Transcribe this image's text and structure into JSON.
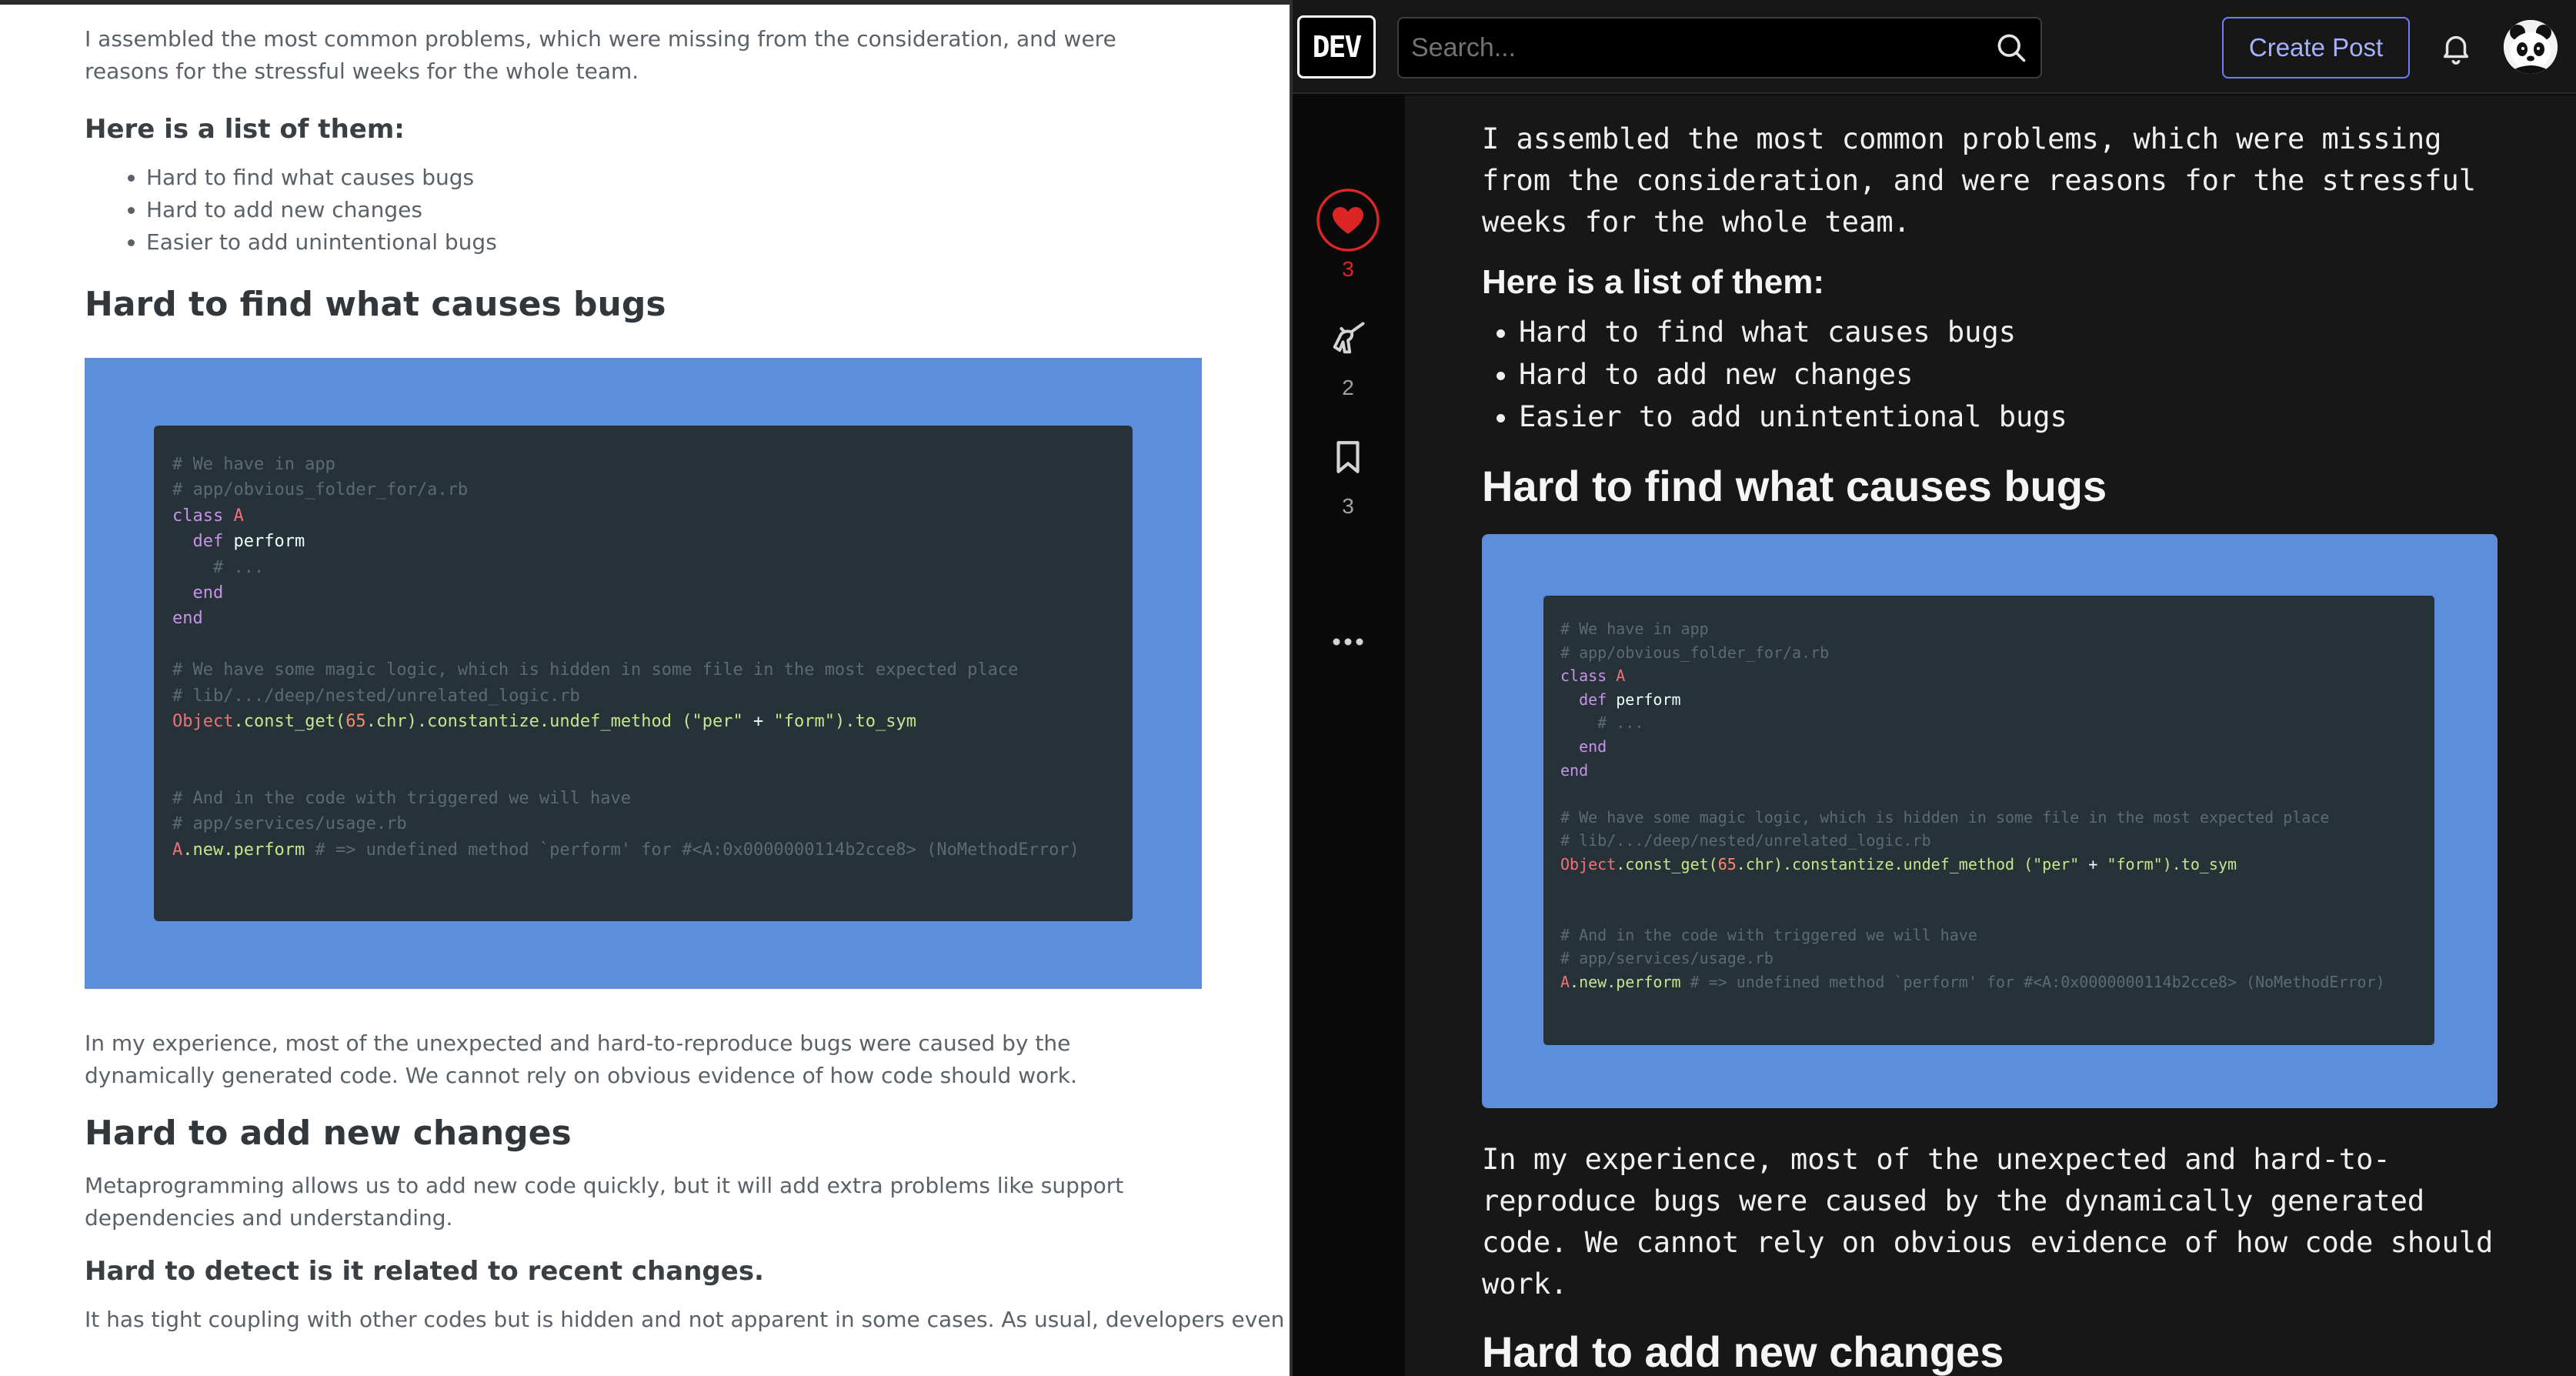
{
  "left_article": {
    "intro": "I assembled the most common problems, which were missing from the consideration, and were reasons for the stressful weeks for the whole team.",
    "list_heading": "Here is a list of them:",
    "list_items": [
      "Hard to find what causes bugs",
      "Hard to add new changes",
      "Easier to add unintentional bugs"
    ],
    "section1_heading": "Hard to find what causes bugs",
    "para_experience": "In my experience, most of the unexpected and hard-to-reproduce bugs were caused by the dynamically generated code. We cannot rely on obvious evidence of how code should work.",
    "section2_heading": "Hard to add new changes",
    "para_metaprogramming": "Metaprogramming allows us to add new code quickly, but it will add extra problems like support dependencies and understanding.",
    "subheading_detect": "Hard to detect is it related to recent changes.",
    "para_coupling": "It has tight coupling with other codes but is hidden and not apparent in some cases. As usual, developers even"
  },
  "code": {
    "l1": "# We have in app",
    "l2": "# app/obvious_folder_for/a.rb",
    "l3_kw": "class",
    "l3_name": "A",
    "l4_kw": "def",
    "l4_name": "perform",
    "l5": "# ...",
    "l6": "end",
    "l7": "end",
    "l9": "# We have some magic logic, which is hidden in some file in the most expected place",
    "l10": "# lib/.../deep/nested/unrelated_logic.rb",
    "l11_obj": "Object",
    "l11_a": ".const_get(",
    "l11_num": "65",
    "l11_b": ".chr).constantize.undef_method (",
    "l11_s1": "\"per\"",
    "l11_plus": " + ",
    "l11_s2": "\"form\"",
    "l11_c": ").to_sym",
    "l14": "# And in the code with triggered we will have",
    "l15": "# app/services/usage.rb",
    "l16_a": "A",
    "l16_b": ".new.perform",
    "l16_com": " # => undefined method `perform' for #<A:0x0000000114b2cce8> (NoMethodError)"
  },
  "header": {
    "logo": "DEV",
    "search_placeholder": "Search...",
    "create_post": "Create Post"
  },
  "reactions": {
    "hearts": "3",
    "unicorns": "2",
    "bookmarks": "3"
  },
  "dark_article": {
    "intro": "I assembled the most common problems, which were missing from the consideration, and were reasons for the stressful weeks for the whole team.",
    "list_heading": "Here is a list of them:",
    "list_items": [
      "Hard to find what causes bugs",
      "Hard to add new changes",
      "Easier to add unintentional bugs"
    ],
    "section1_heading": "Hard to find what causes bugs",
    "para_experience": "In my experience, most of the unexpected and hard-to-reproduce bugs were caused by the dynamically generated code. We cannot rely on obvious evidence of how code should work.",
    "section2_heading": "Hard to add new changes"
  },
  "colors": {
    "accent": "#6e7ff3",
    "heart_red": "#dc2626",
    "code_bg": "#263238",
    "code_frame": "#5d8edc"
  }
}
